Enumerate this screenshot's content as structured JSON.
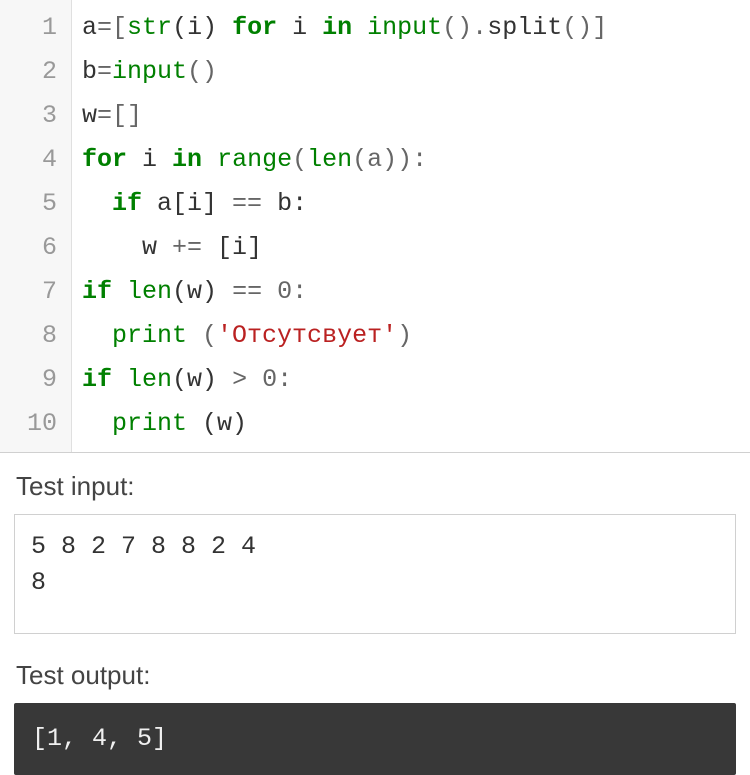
{
  "editor": {
    "lineNumbers": [
      "1",
      "2",
      "3",
      "4",
      "5",
      "6",
      "7",
      "8",
      "9",
      "10"
    ],
    "lines": [
      [
        {
          "t": "a",
          "c": "name"
        },
        {
          "t": "=",
          "c": "op"
        },
        {
          "t": "[",
          "c": "op"
        },
        {
          "t": "str",
          "c": "builtin"
        },
        {
          "t": "(i) ",
          "c": "name"
        },
        {
          "t": "for",
          "c": "kw"
        },
        {
          "t": " i ",
          "c": "name"
        },
        {
          "t": "in",
          "c": "kw"
        },
        {
          "t": " ",
          "c": "name"
        },
        {
          "t": "input",
          "c": "builtin"
        },
        {
          "t": "()",
          "c": "op"
        },
        {
          "t": ".",
          "c": "op"
        },
        {
          "t": "split",
          "c": "name"
        },
        {
          "t": "()]",
          "c": "op"
        }
      ],
      [
        {
          "t": "b",
          "c": "name"
        },
        {
          "t": "=",
          "c": "op"
        },
        {
          "t": "input",
          "c": "builtin"
        },
        {
          "t": "()",
          "c": "op"
        }
      ],
      [
        {
          "t": "w",
          "c": "name"
        },
        {
          "t": "=",
          "c": "op"
        },
        {
          "t": "[]",
          "c": "op"
        }
      ],
      [
        {
          "t": "for",
          "c": "kw"
        },
        {
          "t": " i ",
          "c": "name"
        },
        {
          "t": "in",
          "c": "kw"
        },
        {
          "t": " ",
          "c": "name"
        },
        {
          "t": "range",
          "c": "builtin"
        },
        {
          "t": "(",
          "c": "op"
        },
        {
          "t": "len",
          "c": "builtin"
        },
        {
          "t": "(a)):",
          "c": "op"
        }
      ],
      [
        {
          "t": "  ",
          "c": "name"
        },
        {
          "t": "if",
          "c": "kw"
        },
        {
          "t": " a[i] ",
          "c": "name"
        },
        {
          "t": "==",
          "c": "op"
        },
        {
          "t": " b:",
          "c": "name"
        }
      ],
      [
        {
          "t": "    w ",
          "c": "name"
        },
        {
          "t": "+=",
          "c": "op"
        },
        {
          "t": " [i]",
          "c": "name"
        }
      ],
      [
        {
          "t": "if",
          "c": "kw"
        },
        {
          "t": " ",
          "c": "name"
        },
        {
          "t": "len",
          "c": "builtin"
        },
        {
          "t": "(w) ",
          "c": "name"
        },
        {
          "t": "==",
          "c": "op"
        },
        {
          "t": " ",
          "c": "name"
        },
        {
          "t": "0",
          "c": "num"
        },
        {
          "t": ":",
          "c": "op"
        }
      ],
      [
        {
          "t": "  ",
          "c": "name"
        },
        {
          "t": "print",
          "c": "builtin"
        },
        {
          "t": " (",
          "c": "op"
        },
        {
          "t": "'Отсутсвует'",
          "c": "str"
        },
        {
          "t": ")",
          "c": "op"
        }
      ],
      [
        {
          "t": "if",
          "c": "kw"
        },
        {
          "t": " ",
          "c": "name"
        },
        {
          "t": "len",
          "c": "builtin"
        },
        {
          "t": "(w) ",
          "c": "name"
        },
        {
          "t": ">",
          "c": "op"
        },
        {
          "t": " ",
          "c": "name"
        },
        {
          "t": "0",
          "c": "num"
        },
        {
          "t": ":",
          "c": "op"
        }
      ],
      [
        {
          "t": "  ",
          "c": "name"
        },
        {
          "t": "print",
          "c": "builtin"
        },
        {
          "t": " (w)",
          "c": "name"
        }
      ]
    ]
  },
  "testInputLabel": "Test input:",
  "testInput": "5 8 2 7 8 8 2 4\n8",
  "testOutputLabel": "Test output:",
  "testOutput": "[1, 4, 5]"
}
